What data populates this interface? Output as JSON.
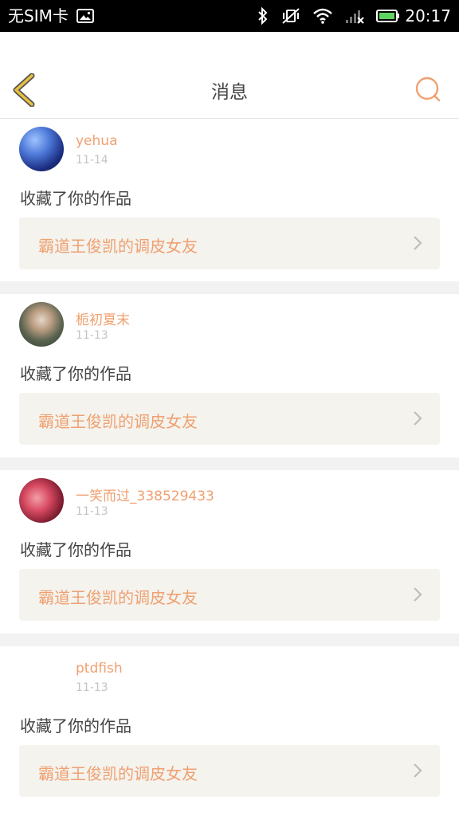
{
  "status_bar": {
    "carrier": "无SIM卡",
    "time": "20:17",
    "icons": [
      "image-icon",
      "bluetooth-icon",
      "vibrate-off-icon",
      "wifi-icon",
      "signal-icon",
      "battery-icon"
    ]
  },
  "header": {
    "title": "消息",
    "back_icon": "chevron-left-icon",
    "search_icon": "search-icon"
  },
  "colors": {
    "accent": "#f0a070",
    "back_arrow": "#e8c040",
    "work_box_bg": "#f4f3ee",
    "separator": "#f2f2f2"
  },
  "messages": [
    {
      "username": "yehua",
      "date": "11-14",
      "action": "收藏了你的作品",
      "work_title": "霸道王俊凯的调皮女友"
    },
    {
      "username": "栀初夏末",
      "date": "11-13",
      "action": "收藏了你的作品",
      "work_title": "霸道王俊凯的调皮女友"
    },
    {
      "username": "一笑而过_338529433",
      "date": "11-13",
      "action": "收藏了你的作品",
      "work_title": "霸道王俊凯的调皮女友"
    },
    {
      "username": "ptdfish",
      "date": "11-13",
      "action": "收藏了你的作品",
      "work_title": "霸道王俊凯的调皮女友"
    }
  ]
}
